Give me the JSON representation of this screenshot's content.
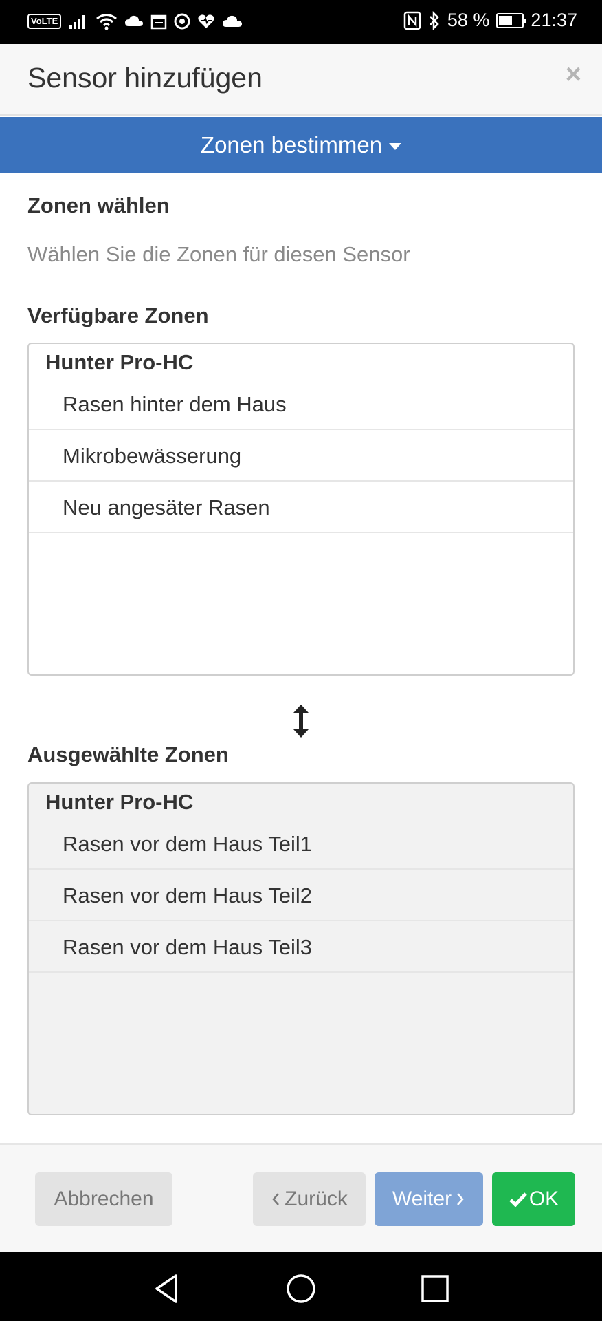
{
  "status_bar": {
    "volte": "VoLTE",
    "battery_text": "58 %",
    "battery_level": 0.58,
    "time": "21:37"
  },
  "modal": {
    "title": "Sensor hinzufügen",
    "close_symbol": "×"
  },
  "step": {
    "label": "Zonen bestimmen"
  },
  "section": {
    "heading": "Zonen wählen",
    "description": "Wählen Sie die Zonen für diesen Sensor"
  },
  "available": {
    "heading": "Verfügbare Zonen",
    "group": "Hunter Pro-HC",
    "items": [
      "Rasen hinter dem Haus",
      "Mikrobewässerung",
      "Neu angesäter Rasen"
    ]
  },
  "selected": {
    "heading": "Ausgewählte Zonen",
    "group": "Hunter Pro-HC",
    "items": [
      "Rasen vor dem Haus Teil1",
      "Rasen vor dem Haus Teil2",
      "Rasen vor dem Haus Teil3"
    ]
  },
  "footer": {
    "cancel": "Abbrechen",
    "back": "Zurück",
    "next": "Weiter",
    "ok": "OK"
  },
  "colors": {
    "step_bar": "#3a72bd",
    "next_button": "#7fa4d6",
    "ok_button": "#1fb851"
  },
  "icons": [
    "volte-icon",
    "signal-icon",
    "wifi-icon",
    "cloud-icon",
    "calendar-icon",
    "chrome-icon",
    "heart-icon",
    "nfc-icon",
    "bluetooth-icon",
    "battery-icon",
    "swap-vertical-icon",
    "check-icon",
    "back-triangle-icon",
    "home-circle-icon",
    "recents-square-icon"
  ]
}
